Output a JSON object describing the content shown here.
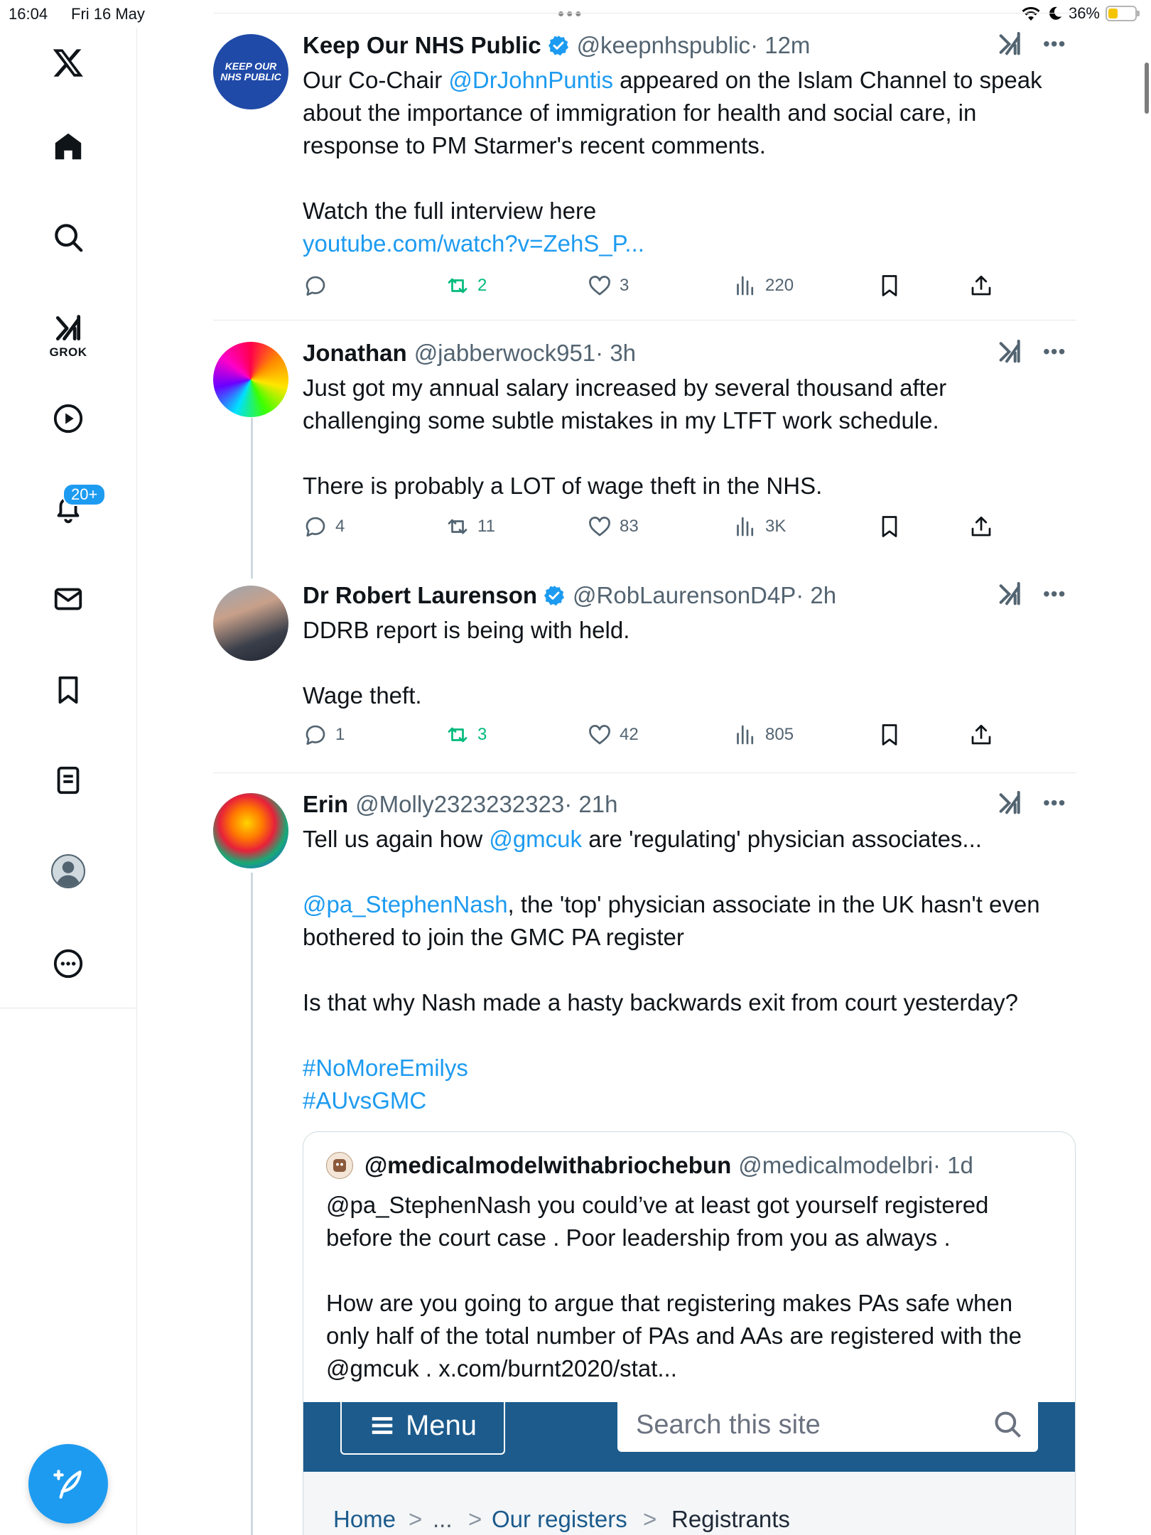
{
  "status_bar": {
    "time": "16:04",
    "date": "Fri 16 May",
    "battery": "36%",
    "battery_level": 0.36
  },
  "sidebar": {
    "logo": "x-logo-icon",
    "items": [
      {
        "name": "home",
        "icon": "home-icon"
      },
      {
        "name": "explore",
        "icon": "search-icon"
      },
      {
        "name": "grok",
        "icon": "grok-icon",
        "label": "GROK"
      },
      {
        "name": "video",
        "icon": "play-icon"
      },
      {
        "name": "notifications",
        "icon": "bell-icon",
        "badge": "20+"
      },
      {
        "name": "messages",
        "icon": "mail-icon"
      },
      {
        "name": "bookmarks",
        "icon": "bookmark-icon"
      },
      {
        "name": "lists",
        "icon": "list-icon"
      },
      {
        "name": "profile",
        "icon": "avatar"
      },
      {
        "name": "more",
        "icon": "more-circle-icon"
      }
    ],
    "compose": "compose-icon"
  },
  "tweets": [
    {
      "name": "Keep Our NHS Public",
      "verified": true,
      "handle": "@keepnhspublic",
      "time": "· 12m",
      "avatar_text": "KEEP OUR NHS PUBLIC",
      "text_1_pre": "Our Co-Chair ",
      "text_1_link": "@DrJohnPuntis",
      "text_1_post": " appeared on the Islam Channel to speak about the importance of immigration for health and social care, in response to PM Starmer's recent comments.",
      "text_2": "Watch the full interview here",
      "link": "youtube.com/watch?v=ZehS_P...",
      "replies": "",
      "retweets": "2",
      "likes": "3",
      "views": "220"
    },
    {
      "name": "Jonathan",
      "verified": false,
      "handle": "@jabberwock951",
      "time": "· 3h",
      "text_1": "Just got my annual salary increased by several thousand after challenging some subtle mistakes in my LTFT work schedule.",
      "text_2": "There is probably a LOT of wage theft in the NHS.",
      "replies": "4",
      "retweets": "11",
      "likes": "83",
      "views": "3K"
    },
    {
      "name": "Dr Robert Laurenson",
      "verified": true,
      "handle": "@RobLaurensonD4P",
      "time": "· 2h",
      "text_1": "DDRB report is being with held.",
      "text_2": "Wage theft.",
      "replies": "1",
      "retweets": "3",
      "likes": "42",
      "views": "805"
    },
    {
      "name": "Erin",
      "verified": false,
      "handle": "@Molly2323232323",
      "time": "· 21h",
      "text_1_pre": "Tell us again how ",
      "text_1_link": "@gmcuk",
      "text_1_post": " are 'regulating' physician associates...",
      "text_2_link": "@pa_StephenNash",
      "text_2_post": ", the 'top' physician associate in the UK hasn't even bothered to join the GMC PA register",
      "text_3": "Is that why Nash made a hasty backwards exit from court yesterday?",
      "hashtag_1": "#NoMoreEmilys",
      "hashtag_2": "#AUvsGMC",
      "quote": {
        "name": "@medicalmodelwithabriochebun",
        "handle": "@medicalmodelbri",
        "time": "· 1d",
        "text_1": "@pa_StephenNash you could’ve at least got yourself registered before the court case . Poor leadership from you as always .",
        "text_2": "How are you going to argue that registering makes PAs safe when only  half of the total number of PAs and AAs are registered with the @gmcuk . x.com/burnt2020/stat...",
        "site_menu": "Menu",
        "site_search_placeholder": "Search this site",
        "breadcrumb": [
          "Home",
          ">",
          "...",
          ">",
          "Our registers",
          ">",
          "Registrants"
        ]
      }
    }
  ],
  "colors": {
    "accent": "#1d9bf0",
    "retweet_active": "#00ba7c",
    "muted": "#536471",
    "gmc_banner": "#1c5b8c"
  }
}
